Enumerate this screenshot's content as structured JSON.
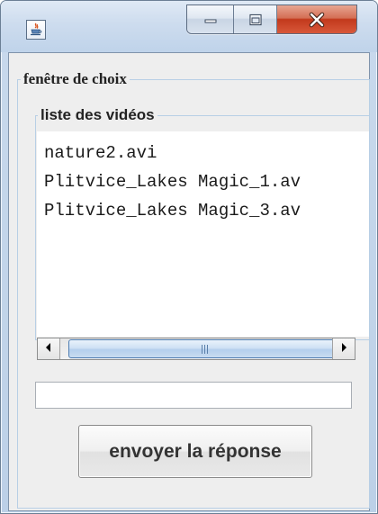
{
  "window": {
    "title": "",
    "app_icon": "java-cup-icon",
    "caption_buttons": [
      "minimize-icon",
      "maximize-icon",
      "close-icon"
    ],
    "accent_colors": {
      "titlebar": "#c8d9ec",
      "close_button": "#c2391c",
      "border_title": "#b8cfe5"
    }
  },
  "panel": {
    "title": "fenêtre de choix"
  },
  "video_list": {
    "title": "liste des vidéos",
    "items": [
      "nature2.avi",
      "Plitvice_Lakes Magic_1.av",
      "Plitvice_Lakes Magic_3.av"
    ]
  },
  "scrollbar": {
    "orientation": "horizontal",
    "left_arrow_icon": "arrow-left-icon",
    "right_arrow_icon": "arrow-right-icon"
  },
  "answer_field": {
    "value": ""
  },
  "send_button": {
    "label": "envoyer la réponse"
  }
}
